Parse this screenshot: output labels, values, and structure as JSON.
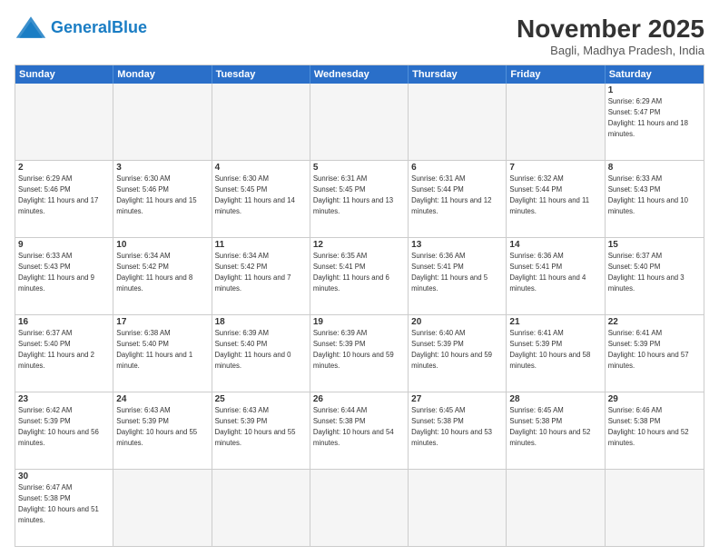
{
  "header": {
    "logo_general": "General",
    "logo_blue": "Blue",
    "month_year": "November 2025",
    "location": "Bagli, Madhya Pradesh, India"
  },
  "days_of_week": [
    "Sunday",
    "Monday",
    "Tuesday",
    "Wednesday",
    "Thursday",
    "Friday",
    "Saturday"
  ],
  "rows": [
    [
      {
        "day": "",
        "empty": true
      },
      {
        "day": "",
        "empty": true
      },
      {
        "day": "",
        "empty": true
      },
      {
        "day": "",
        "empty": true
      },
      {
        "day": "",
        "empty": true
      },
      {
        "day": "",
        "empty": true
      },
      {
        "day": "1",
        "rise": "6:29 AM",
        "set": "5:47 PM",
        "light": "11 hours and 18 minutes."
      }
    ],
    [
      {
        "day": "2",
        "rise": "6:29 AM",
        "set": "5:46 PM",
        "light": "11 hours and 17 minutes."
      },
      {
        "day": "3",
        "rise": "6:30 AM",
        "set": "5:46 PM",
        "light": "11 hours and 15 minutes."
      },
      {
        "day": "4",
        "rise": "6:30 AM",
        "set": "5:45 PM",
        "light": "11 hours and 14 minutes."
      },
      {
        "day": "5",
        "rise": "6:31 AM",
        "set": "5:45 PM",
        "light": "11 hours and 13 minutes."
      },
      {
        "day": "6",
        "rise": "6:31 AM",
        "set": "5:44 PM",
        "light": "11 hours and 12 minutes."
      },
      {
        "day": "7",
        "rise": "6:32 AM",
        "set": "5:44 PM",
        "light": "11 hours and 11 minutes."
      },
      {
        "day": "8",
        "rise": "6:33 AM",
        "set": "5:43 PM",
        "light": "11 hours and 10 minutes."
      }
    ],
    [
      {
        "day": "9",
        "rise": "6:33 AM",
        "set": "5:43 PM",
        "light": "11 hours and 9 minutes."
      },
      {
        "day": "10",
        "rise": "6:34 AM",
        "set": "5:42 PM",
        "light": "11 hours and 8 minutes."
      },
      {
        "day": "11",
        "rise": "6:34 AM",
        "set": "5:42 PM",
        "light": "11 hours and 7 minutes."
      },
      {
        "day": "12",
        "rise": "6:35 AM",
        "set": "5:41 PM",
        "light": "11 hours and 6 minutes."
      },
      {
        "day": "13",
        "rise": "6:36 AM",
        "set": "5:41 PM",
        "light": "11 hours and 5 minutes."
      },
      {
        "day": "14",
        "rise": "6:36 AM",
        "set": "5:41 PM",
        "light": "11 hours and 4 minutes."
      },
      {
        "day": "15",
        "rise": "6:37 AM",
        "set": "5:40 PM",
        "light": "11 hours and 3 minutes."
      }
    ],
    [
      {
        "day": "16",
        "rise": "6:37 AM",
        "set": "5:40 PM",
        "light": "11 hours and 2 minutes."
      },
      {
        "day": "17",
        "rise": "6:38 AM",
        "set": "5:40 PM",
        "light": "11 hours and 1 minute."
      },
      {
        "day": "18",
        "rise": "6:39 AM",
        "set": "5:40 PM",
        "light": "11 hours and 0 minutes."
      },
      {
        "day": "19",
        "rise": "6:39 AM",
        "set": "5:39 PM",
        "light": "10 hours and 59 minutes."
      },
      {
        "day": "20",
        "rise": "6:40 AM",
        "set": "5:39 PM",
        "light": "10 hours and 59 minutes."
      },
      {
        "day": "21",
        "rise": "6:41 AM",
        "set": "5:39 PM",
        "light": "10 hours and 58 minutes."
      },
      {
        "day": "22",
        "rise": "6:41 AM",
        "set": "5:39 PM",
        "light": "10 hours and 57 minutes."
      }
    ],
    [
      {
        "day": "23",
        "rise": "6:42 AM",
        "set": "5:39 PM",
        "light": "10 hours and 56 minutes."
      },
      {
        "day": "24",
        "rise": "6:43 AM",
        "set": "5:39 PM",
        "light": "10 hours and 55 minutes."
      },
      {
        "day": "25",
        "rise": "6:43 AM",
        "set": "5:39 PM",
        "light": "10 hours and 55 minutes."
      },
      {
        "day": "26",
        "rise": "6:44 AM",
        "set": "5:38 PM",
        "light": "10 hours and 54 minutes."
      },
      {
        "day": "27",
        "rise": "6:45 AM",
        "set": "5:38 PM",
        "light": "10 hours and 53 minutes."
      },
      {
        "day": "28",
        "rise": "6:45 AM",
        "set": "5:38 PM",
        "light": "10 hours and 52 minutes."
      },
      {
        "day": "29",
        "rise": "6:46 AM",
        "set": "5:38 PM",
        "light": "10 hours and 52 minutes."
      }
    ],
    [
      {
        "day": "30",
        "rise": "6:47 AM",
        "set": "5:38 PM",
        "light": "10 hours and 51 minutes."
      },
      {
        "day": "",
        "empty": true
      },
      {
        "day": "",
        "empty": true
      },
      {
        "day": "",
        "empty": true
      },
      {
        "day": "",
        "empty": true
      },
      {
        "day": "",
        "empty": true
      },
      {
        "day": "",
        "empty": true
      }
    ]
  ]
}
